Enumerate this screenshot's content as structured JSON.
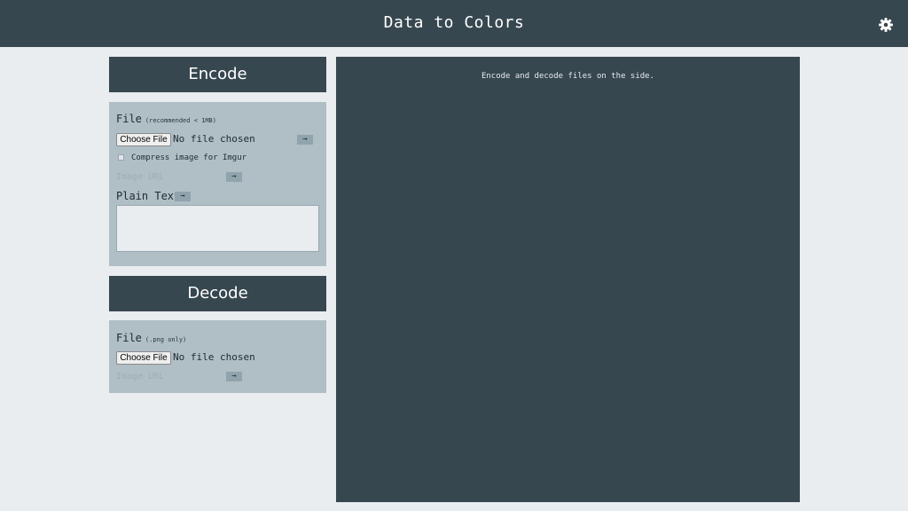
{
  "app": {
    "title": "Data to Colors",
    "settings_icon": "gear-icon"
  },
  "encode": {
    "heading": "Encode",
    "file_label": "File",
    "file_hint": "(recommended < 1MB)",
    "choose_file_label": "Choose File",
    "no_file_text": "No file chosen",
    "arrow": "→",
    "compress_label": "Compress image for Imgur",
    "compress_checked": false,
    "image_url_placeholder": "Image URL",
    "image_url_value": "",
    "plain_text_label": "Plain Text",
    "plain_text_value": ""
  },
  "decode": {
    "heading": "Decode",
    "file_label": "File",
    "file_hint": "(.png only)",
    "choose_file_label": "Choose File",
    "no_file_text": "No file chosen",
    "arrow": "→",
    "image_url_placeholder": "Image URL",
    "image_url_value": ""
  },
  "output": {
    "message": "Encode and decode files on the side."
  },
  "colors": {
    "header_bg": "#37474f",
    "page_bg": "#e9edf0",
    "panel_bg": "#b0bec5",
    "button_bg": "#90a4ae"
  }
}
